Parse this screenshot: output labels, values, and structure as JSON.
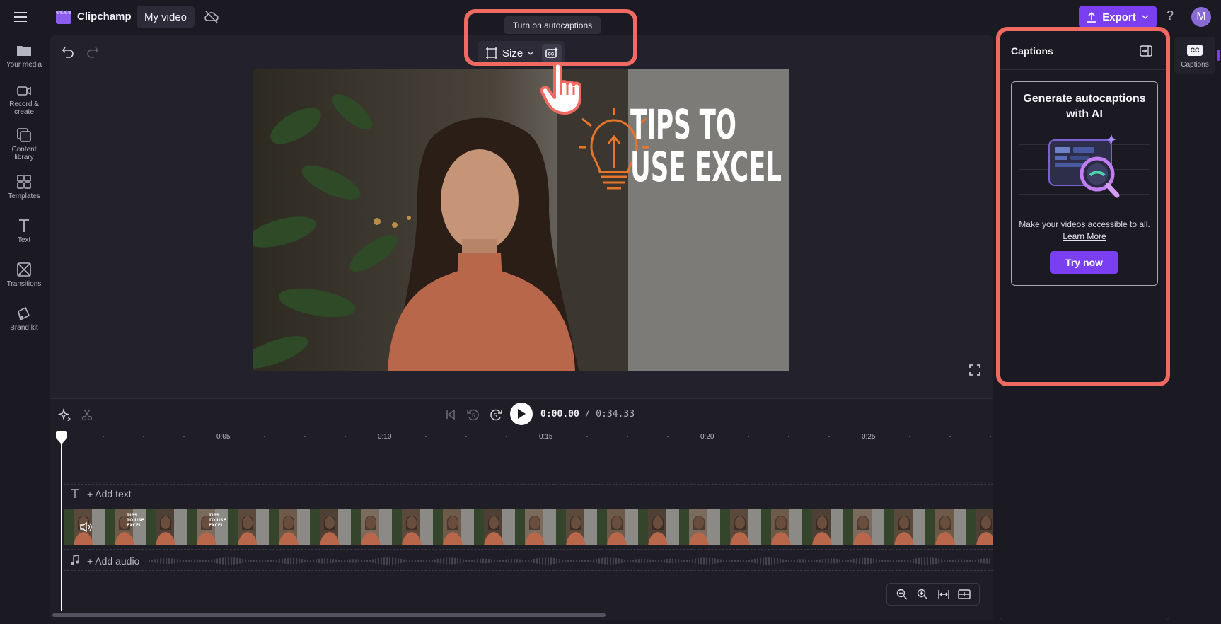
{
  "app": {
    "brand": "Clipchamp",
    "project_title": "My video"
  },
  "topbar": {
    "export_label": "Export",
    "help_label": "?",
    "avatar_initial": "M"
  },
  "sidebar": {
    "items": [
      {
        "label": "Your media",
        "icon": "folder-icon"
      },
      {
        "label": "Record & create",
        "icon": "camera-icon"
      },
      {
        "label": "Content library",
        "icon": "library-icon"
      },
      {
        "label": "Templates",
        "icon": "templates-icon"
      },
      {
        "label": "Text",
        "icon": "text-icon"
      },
      {
        "label": "Transitions",
        "icon": "transitions-icon"
      },
      {
        "label": "Brand kit",
        "icon": "brand-kit-icon"
      }
    ]
  },
  "toolbar": {
    "size_label": "Size",
    "tooltip": "Turn on autocaptions"
  },
  "preview": {
    "line1": "TIPS TO",
    "line2": "USE EXCEL"
  },
  "captions_panel": {
    "title": "Captions",
    "card_title": "Generate autocaptions with AI",
    "description": "Make your videos accessible to all.",
    "learn_more": "Learn More",
    "try_button": "Try now"
  },
  "right_tab": {
    "label": "Captions",
    "icon_text": "CC"
  },
  "timeline": {
    "current_time": "0:00.00",
    "total_time": "/ 0:34.33",
    "ruler_labels": [
      "0:05",
      "0:10",
      "0:15",
      "0:20",
      "0:25"
    ],
    "add_text_label": "+ Add text",
    "add_audio_label": "+ Add audio",
    "thumbnail_text": "TIPS TO USE EXCEL"
  },
  "colors": {
    "accent": "#7b3ff2",
    "highlight": "#f06a61",
    "background": "#1b1a22"
  }
}
